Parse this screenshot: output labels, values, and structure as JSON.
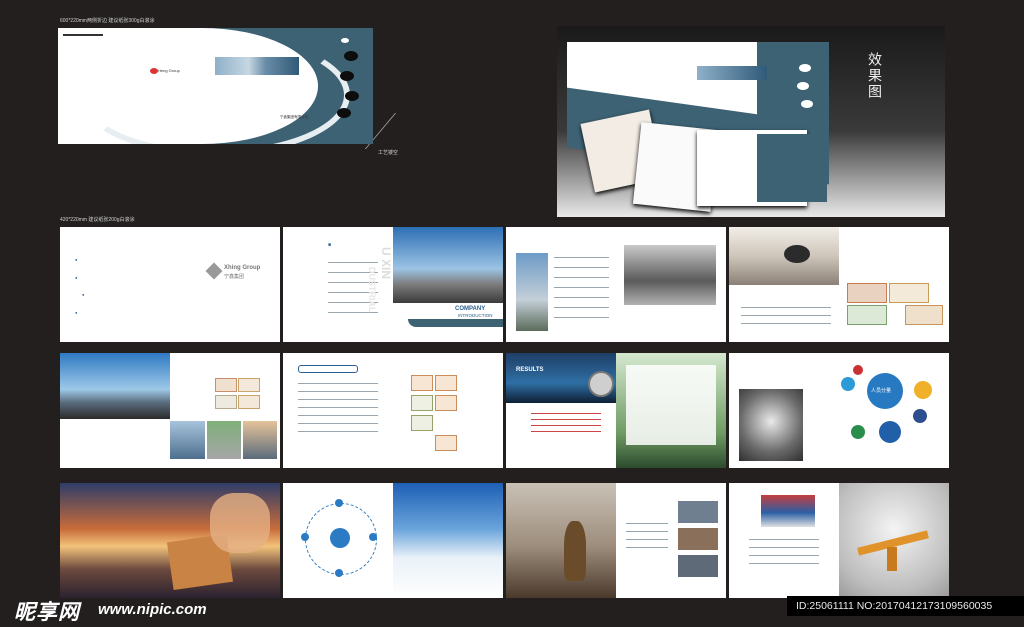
{
  "labels": {
    "cover_spec": "600*220mm两侧折边 建议纸张300g白滚涂",
    "craft_note": "工艺镂空",
    "inner_spec": "420*220mm 建议纸张200g白滚涂",
    "effect_title": "效果图"
  },
  "cover": {
    "logo_text": "Heng Group",
    "company_name": "宁鑫集团有限公司"
  },
  "pages": {
    "toc_logo_en": "Xhing Group",
    "toc_logo_cn": "宁鑫集团",
    "vertical_text_1": "U XIN",
    "vertical_text_2": "DUSTRIAL",
    "intro_heading": "COMPANY",
    "intro_sub": "INTRODUCTION",
    "results": "RESULTS",
    "people": "人员分量"
  },
  "watermark": {
    "site_cn": "昵享网",
    "site_url": "www.nipic.com",
    "id_text": "ID:25061111 NO:20170412173109560035"
  },
  "colors": {
    "background": "#231f1f",
    "brand_blue": "#3d6274",
    "accent": "#2a5d8f"
  }
}
